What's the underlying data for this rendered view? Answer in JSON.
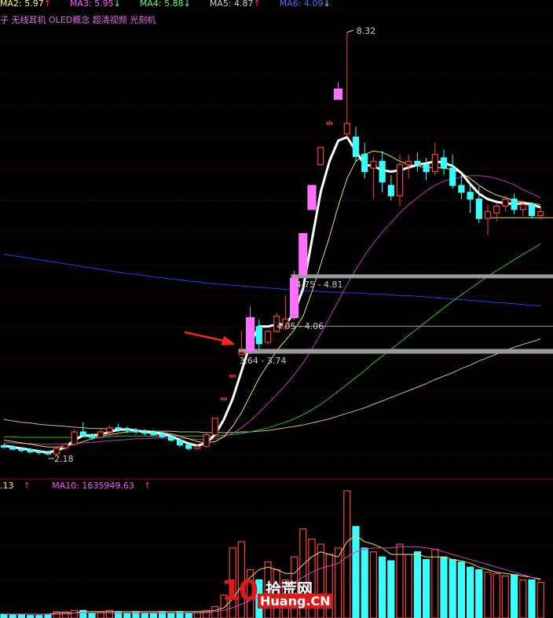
{
  "legend_ma": [
    {
      "name": "MA2",
      "value": "5.97",
      "arrow": "↑",
      "color": "#ffff55"
    },
    {
      "name": "MA3",
      "value": "5.95",
      "arrow": "↓",
      "color": "#ff55ff"
    },
    {
      "name": "MA4",
      "value": "5.88",
      "arrow": "↓",
      "color": "#55ff55"
    },
    {
      "name": "MA5",
      "value": "4.87",
      "arrow": "↑",
      "color": "#cccccc"
    },
    {
      "name": "MA6",
      "value": "4.09",
      "arrow": "↓",
      "color": "#4a6bff"
    }
  ],
  "concept_text": "子 无线耳机 OLED概念 超清视频 光刻机",
  "legend_vol": {
    "prefix": ".13",
    "prefix_arrow": "↑",
    "ma10_label": "MA10: 1635949.63",
    "ma10_arrow": "↑"
  },
  "annotations": {
    "peak": "8.32",
    "low": "2.18",
    "zone_high": "4.75 - 4.81",
    "zone_mid": "4.05 - 4.06",
    "zone_low": "3.64 - 3.74"
  },
  "watermark": {
    "logo": "10",
    "cn": "拾荒网",
    "en": "Huang.CN"
  },
  "colors": {
    "up": "#ff3b3b",
    "down": "#39ffff",
    "up_fill": "#ff70ff",
    "ma_white": "#ffffff",
    "ma_yellow": "#e9e34a",
    "ma_magenta": "#c230c2",
    "ma_green": "#1fc41f",
    "ma_beige": "#c9b89a",
    "ma_blue": "#1f3cff",
    "grid": "#6b0000"
  },
  "chart_data": {
    "type": "candlestick",
    "ylim": [
      1.95,
      8.45
    ],
    "candles": [
      [
        2.32,
        2.35,
        2.28,
        2.3
      ],
      [
        2.3,
        2.33,
        2.25,
        2.27
      ],
      [
        2.27,
        2.3,
        2.22,
        2.25
      ],
      [
        2.25,
        2.28,
        2.21,
        2.24
      ],
      [
        2.24,
        2.26,
        2.19,
        2.22
      ],
      [
        2.22,
        2.25,
        2.18,
        2.2
      ],
      [
        2.2,
        2.3,
        2.18,
        2.28
      ],
      [
        2.29,
        2.36,
        2.26,
        2.34
      ],
      [
        2.34,
        2.55,
        2.32,
        2.52
      ],
      [
        2.52,
        2.66,
        2.45,
        2.47
      ],
      [
        2.47,
        2.5,
        2.4,
        2.44
      ],
      [
        2.44,
        2.56,
        2.42,
        2.52
      ],
      [
        2.52,
        2.62,
        2.48,
        2.58
      ],
      [
        2.58,
        2.64,
        2.52,
        2.56
      ],
      [
        2.56,
        2.6,
        2.5,
        2.54
      ],
      [
        2.54,
        2.58,
        2.49,
        2.52
      ],
      [
        2.52,
        2.56,
        2.47,
        2.5
      ],
      [
        2.5,
        2.55,
        2.46,
        2.49
      ],
      [
        2.49,
        2.52,
        2.43,
        2.45
      ],
      [
        2.45,
        2.48,
        2.38,
        2.4
      ],
      [
        2.4,
        2.43,
        2.3,
        2.33
      ],
      [
        2.33,
        2.36,
        2.25,
        2.28
      ],
      [
        2.28,
        2.33,
        2.26,
        2.31
      ],
      [
        2.31,
        2.5,
        2.29,
        2.48
      ],
      [
        2.48,
        2.73,
        2.46,
        2.72
      ],
      [
        3.0,
        3.0,
        3.0,
        3.0
      ],
      [
        3.33,
        3.33,
        3.33,
        3.33
      ],
      [
        3.64,
        3.99,
        3.64,
        3.68
      ],
      [
        3.7,
        4.33,
        3.65,
        4.18
      ],
      [
        4.05,
        4.15,
        3.72,
        3.8
      ],
      [
        3.82,
        4.0,
        3.8,
        3.98
      ],
      [
        3.98,
        4.25,
        3.96,
        4.2
      ],
      [
        4.05,
        4.5,
        4.0,
        4.16
      ],
      [
        4.18,
        4.86,
        4.15,
        4.75
      ],
      [
        4.8,
        5.4,
        4.78,
        5.4
      ],
      [
        5.75,
        6.1,
        5.75,
        6.1
      ],
      [
        6.4,
        6.65,
        6.4,
        6.65
      ],
      [
        7.0,
        7.05,
        6.99,
        7.0
      ],
      [
        7.35,
        7.6,
        7.35,
        7.5
      ],
      [
        6.85,
        8.32,
        6.8,
        7.0
      ],
      [
        6.8,
        6.95,
        6.45,
        6.52
      ],
      [
        6.55,
        6.72,
        6.2,
        6.3
      ],
      [
        6.35,
        6.52,
        5.9,
        6.45
      ],
      [
        6.45,
        6.6,
        6.0,
        6.15
      ],
      [
        6.1,
        6.25,
        5.88,
        5.95
      ],
      [
        5.95,
        6.55,
        5.8,
        6.4
      ],
      [
        6.4,
        6.55,
        6.2,
        6.45
      ],
      [
        6.45,
        6.58,
        6.3,
        6.4
      ],
      [
        6.4,
        6.5,
        6.18,
        6.3
      ],
      [
        6.3,
        6.72,
        6.25,
        6.55
      ],
      [
        6.5,
        6.62,
        6.25,
        6.35
      ],
      [
        6.35,
        6.55,
        6.05,
        6.1
      ],
      [
        6.1,
        6.25,
        5.9,
        6.0
      ],
      [
        6.0,
        6.12,
        5.7,
        5.9
      ],
      [
        5.9,
        6.08,
        5.55,
        5.62
      ],
      [
        5.62,
        5.82,
        5.38,
        5.72
      ],
      [
        5.7,
        5.85,
        5.58,
        5.8
      ],
      [
        5.8,
        5.95,
        5.72,
        5.9
      ],
      [
        5.9,
        5.98,
        5.68,
        5.75
      ],
      [
        5.75,
        5.88,
        5.65,
        5.82
      ],
      [
        5.82,
        5.86,
        5.62,
        5.66
      ],
      [
        5.66,
        5.78,
        5.6,
        5.72
      ]
    ],
    "ma_white": [
      2.32,
      2.3,
      2.28,
      2.26,
      2.24,
      2.22,
      2.25,
      2.3,
      2.4,
      2.47,
      2.47,
      2.48,
      2.52,
      2.55,
      2.56,
      2.54,
      2.52,
      2.51,
      2.49,
      2.46,
      2.4,
      2.35,
      2.32,
      2.36,
      2.48,
      2.7,
      3.0,
      3.4,
      3.8,
      4.05,
      4.05,
      4.08,
      4.08,
      4.25,
      4.6,
      5.3,
      6.0,
      6.45,
      6.75,
      6.8,
      6.6,
      6.4,
      6.38,
      6.32,
      6.3,
      6.32,
      6.36,
      6.4,
      6.42,
      6.45,
      6.43,
      6.38,
      6.28,
      6.12,
      5.98,
      5.9,
      5.86,
      5.84,
      5.83,
      5.84,
      5.82,
      5.78
    ],
    "ma_yellow": [
      2.4,
      2.38,
      2.36,
      2.34,
      2.32,
      2.3,
      2.3,
      2.31,
      2.34,
      2.38,
      2.42,
      2.45,
      2.48,
      2.5,
      2.52,
      2.52,
      2.52,
      2.52,
      2.51,
      2.49,
      2.46,
      2.42,
      2.38,
      2.36,
      2.38,
      2.45,
      2.6,
      2.8,
      3.05,
      3.3,
      3.5,
      3.7,
      3.85,
      4.0,
      4.2,
      4.55,
      4.95,
      5.35,
      5.8,
      6.2,
      6.45,
      6.55,
      6.6,
      6.58,
      6.52,
      6.45,
      6.4,
      6.38,
      6.36,
      6.36,
      6.35,
      6.33,
      6.28,
      6.2,
      6.1,
      6.02,
      5.96,
      5.92,
      5.88,
      5.86,
      5.84,
      5.82
    ],
    "ma_magenta": [
      2.36,
      2.36,
      2.35,
      2.35,
      2.34,
      2.34,
      2.34,
      2.34,
      2.35,
      2.36,
      2.37,
      2.38,
      2.39,
      2.4,
      2.41,
      2.42,
      2.42,
      2.43,
      2.43,
      2.43,
      2.43,
      2.42,
      2.41,
      2.41,
      2.42,
      2.45,
      2.5,
      2.58,
      2.68,
      2.8,
      2.93,
      3.06,
      3.2,
      3.35,
      3.52,
      3.72,
      3.94,
      4.18,
      4.42,
      4.66,
      4.88,
      5.08,
      5.26,
      5.42,
      5.56,
      5.7,
      5.82,
      5.92,
      6.02,
      6.1,
      6.16,
      6.2,
      6.22,
      6.24,
      6.24,
      6.23,
      6.2,
      6.16,
      6.11,
      6.04,
      5.98,
      5.92
    ],
    "ma_green": [
      2.45,
      2.45,
      2.44,
      2.44,
      2.44,
      2.44,
      2.44,
      2.44,
      2.44,
      2.45,
      2.45,
      2.45,
      2.45,
      2.46,
      2.46,
      2.46,
      2.46,
      2.46,
      2.46,
      2.46,
      2.46,
      2.46,
      2.46,
      2.46,
      2.46,
      2.47,
      2.48,
      2.5,
      2.52,
      2.55,
      2.58,
      2.62,
      2.66,
      2.71,
      2.77,
      2.84,
      2.92,
      3.01,
      3.11,
      3.21,
      3.31,
      3.41,
      3.52,
      3.62,
      3.72,
      3.82,
      3.92,
      4.02,
      4.12,
      4.22,
      4.32,
      4.42,
      4.51,
      4.6,
      4.69,
      4.78,
      4.86,
      4.94,
      5.02,
      5.1,
      5.17,
      5.25
    ],
    "ma_beige": [
      2.7,
      2.68,
      2.66,
      2.65,
      2.63,
      2.62,
      2.61,
      2.6,
      2.59,
      2.58,
      2.57,
      2.57,
      2.56,
      2.55,
      2.55,
      2.54,
      2.54,
      2.53,
      2.53,
      2.53,
      2.52,
      2.52,
      2.52,
      2.51,
      2.51,
      2.51,
      2.51,
      2.52,
      2.52,
      2.53,
      2.54,
      2.56,
      2.58,
      2.6,
      2.62,
      2.65,
      2.68,
      2.71,
      2.75,
      2.79,
      2.83,
      2.87,
      2.92,
      2.97,
      3.02,
      3.07,
      3.12,
      3.17,
      3.22,
      3.28,
      3.33,
      3.38,
      3.44,
      3.49,
      3.55,
      3.6,
      3.65,
      3.7,
      3.75,
      3.79,
      3.83,
      3.87
    ],
    "ma_blue": [
      5.1,
      5.08,
      5.06,
      5.04,
      5.02,
      5.0,
      4.98,
      4.96,
      4.94,
      4.92,
      4.9,
      4.88,
      4.86,
      4.84,
      4.82,
      4.81,
      4.79,
      4.77,
      4.76,
      4.74,
      4.73,
      4.71,
      4.7,
      4.68,
      4.67,
      4.66,
      4.65,
      4.64,
      4.63,
      4.62,
      4.61,
      4.6,
      4.59,
      4.58,
      4.57,
      4.57,
      4.56,
      4.55,
      4.55,
      4.54,
      4.54,
      4.53,
      4.52,
      4.52,
      4.51,
      4.5,
      4.5,
      4.49,
      4.48,
      4.47,
      4.46,
      4.45,
      4.44,
      4.43,
      4.42,
      4.41,
      4.4,
      4.39,
      4.38,
      4.37,
      4.36,
      4.35
    ],
    "volumes": [
      3,
      3,
      3,
      2,
      2,
      3,
      5,
      5,
      6,
      6,
      4,
      5,
      6,
      5,
      4,
      5,
      4,
      4,
      5,
      4,
      5,
      4,
      5,
      6,
      9,
      18,
      55,
      60,
      38,
      30,
      44,
      38,
      30,
      48,
      70,
      62,
      58,
      50,
      55,
      100,
      72,
      55,
      52,
      48,
      45,
      58,
      50,
      52,
      46,
      54,
      48,
      46,
      44,
      40,
      38,
      36,
      35,
      33,
      34,
      30,
      30,
      28
    ],
    "vol_ma_yellow": [
      3,
      3,
      3,
      3,
      3,
      3,
      4,
      4,
      4,
      5,
      5,
      5,
      5,
      5,
      5,
      5,
      5,
      5,
      5,
      5,
      5,
      5,
      5,
      5,
      6,
      8,
      15,
      25,
      32,
      38,
      40,
      38,
      35,
      35,
      42,
      48,
      52,
      50,
      48,
      60,
      65,
      60,
      58,
      55,
      50,
      50,
      50,
      50,
      48,
      48,
      48,
      46,
      45,
      43,
      40,
      38,
      36,
      35,
      34,
      33,
      32,
      30
    ],
    "vol_ma_magenta": [
      3,
      3,
      3,
      3,
      3,
      3,
      3,
      3,
      4,
      4,
      4,
      4,
      4,
      4,
      4,
      4,
      4,
      4,
      4,
      4,
      4,
      4,
      4,
      4,
      5,
      6,
      8,
      11,
      14,
      17,
      20,
      23,
      25,
      28,
      32,
      36,
      39,
      41,
      43,
      48,
      52,
      54,
      55,
      55,
      55,
      56,
      56,
      56,
      55,
      54,
      52,
      50,
      48,
      46,
      44,
      42,
      40,
      38,
      36,
      34,
      32,
      31
    ]
  }
}
